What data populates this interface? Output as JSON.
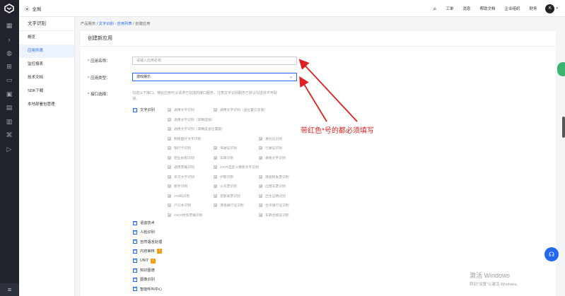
{
  "topbar": {
    "region": "全局",
    "nav": [
      "工单",
      "消息",
      "帮助文档",
      "企业组织",
      "财务"
    ],
    "avatar": "K"
  },
  "sidebar": {
    "title": "文字识别",
    "items": [
      {
        "label": "概览",
        "active": false
      },
      {
        "label": "应用列表",
        "active": true
      },
      {
        "label": "监控报表",
        "active": false
      },
      {
        "label": "技术文档",
        "active": false
      },
      {
        "label": "SDK下载",
        "active": false
      },
      {
        "label": "本地部署包管理",
        "active": false
      }
    ]
  },
  "breadcrumb": {
    "items": [
      "产品服务",
      "文字识别 - 应用列表",
      "创建应用"
    ]
  },
  "form": {
    "title": "创建新应用",
    "name_label": "应用名称：",
    "name_placeholder": "请输入应用名称",
    "type_label": "应用类型：",
    "type_value": "游戏娱乐",
    "api_label": "接口选择：",
    "api_tip_line1": "勾选以下接口，使此应用可以请求已勾选的接口服务，注意文字识别服务已默认勾选并不可取",
    "api_tip_line2": "消。"
  },
  "ocr": {
    "label": "文字识别",
    "rows": [
      [
        "通用文字识别",
        "通用文字识别（含位置信息版）"
      ],
      [
        "通用文字识别（高精度版）"
      ],
      [
        "通用文字识别（高精度含位置版）"
      ],
      [
        "网络图片文字识别",
        "",
        "身份证识别"
      ],
      [
        "银行卡识别",
        "驾驶证识别",
        "行驶证识别"
      ],
      [
        "营业执照识别",
        "车牌识别",
        "表格文字识别"
      ],
      [
        "通用票据识别",
        "iOCR自定义模板文字识别"
      ],
      [
        "多可文字识别",
        "护照识别",
        "增值税发票识别"
      ],
      [
        "数字识别",
        "火车票识别",
        "出租车票识别"
      ],
      [
        "VIN码识别",
        "定额发票识别",
        "出生证明识别"
      ],
      [
        "户口本识别",
        "港澳通行证识别",
        "台湾通行证识别"
      ],
      [
        "iOCR财会票据识别",
        "",
        "车辆合格证识别"
      ]
    ]
  },
  "categories": [
    {
      "label": "语音技术",
      "badge": ""
    },
    {
      "label": "人脸识别",
      "badge": ""
    },
    {
      "label": "自然语言处理",
      "badge": ""
    },
    {
      "label": "内容审核",
      "badge": "!"
    },
    {
      "label": "UNIT",
      "badge": "!"
    },
    {
      "label": "知识图谱",
      "badge": ""
    },
    {
      "label": "图像识别",
      "badge": ""
    },
    {
      "label": "智能呼叫中心",
      "badge": ""
    }
  ],
  "annotation": "带红色*号的都必须填写",
  "watermark": {
    "line1": "激活 Windows",
    "line2": "转到\"设置\"以激活 Windows。"
  },
  "colors": {
    "accent": "#2468f2",
    "required": "#e02020",
    "rail": "#20232b"
  }
}
